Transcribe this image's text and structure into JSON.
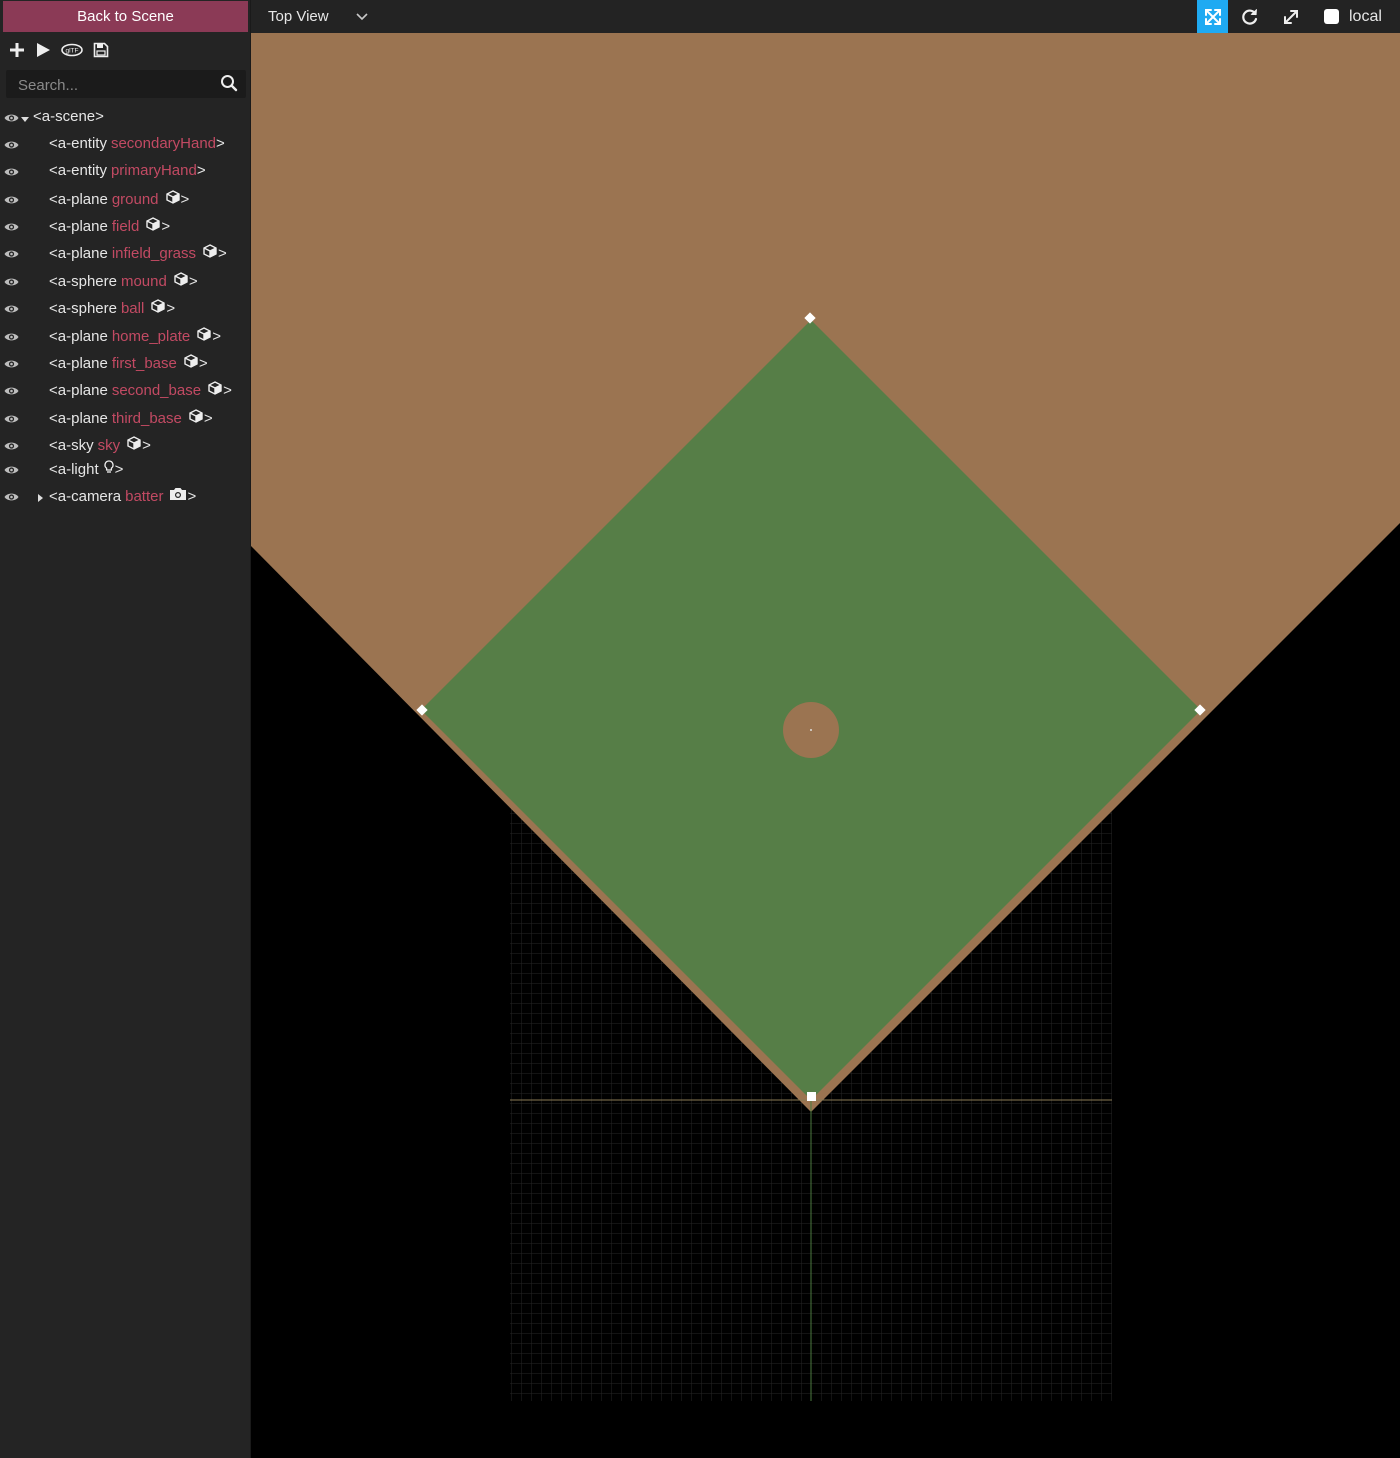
{
  "sidebar": {
    "back_label": "Back to Scene",
    "search_placeholder": "Search...",
    "toolbar_icons": [
      "add-entity-icon",
      "play-icon",
      "gltf-export-icon",
      "save-icon"
    ]
  },
  "outliner": {
    "root": "<a-scene>",
    "rows": [
      {
        "tag": "<a-entity",
        "name": "secondaryHand",
        "icon": "none",
        "close": ">"
      },
      {
        "tag": "<a-entity",
        "name": "primaryHand",
        "icon": "none",
        "close": ">"
      },
      {
        "tag": "<a-plane",
        "name": "ground",
        "icon": "cube-icon",
        "close": ">"
      },
      {
        "tag": "<a-plane",
        "name": "field",
        "icon": "cube-icon",
        "close": ">"
      },
      {
        "tag": "<a-plane",
        "name": "infield_grass",
        "icon": "cube-icon",
        "close": ">"
      },
      {
        "tag": "<a-sphere",
        "name": "mound",
        "icon": "cube-icon",
        "close": ">"
      },
      {
        "tag": "<a-sphere",
        "name": "ball",
        "icon": "cube-icon",
        "close": ">"
      },
      {
        "tag": "<a-plane",
        "name": "home_plate",
        "icon": "cube-icon",
        "close": ">"
      },
      {
        "tag": "<a-plane",
        "name": "first_base",
        "icon": "cube-icon",
        "close": ">"
      },
      {
        "tag": "<a-plane",
        "name": "second_base",
        "icon": "cube-icon",
        "close": ">"
      },
      {
        "tag": "<a-plane",
        "name": "third_base",
        "icon": "cube-icon",
        "close": ">"
      },
      {
        "tag": "<a-sky",
        "name": "sky",
        "icon": "cube-icon",
        "close": ">"
      },
      {
        "tag": "<a-light",
        "name": "",
        "icon": "bulb-icon",
        "close": ">"
      },
      {
        "tag": "<a-camera",
        "name": "batter",
        "icon": "camera-icon",
        "close": ">"
      }
    ]
  },
  "topbar": {
    "view": "Top View",
    "tools": [
      "translate-icon",
      "rotate-icon",
      "scale-icon"
    ],
    "active_tool": "translate-icon",
    "local_label": "local"
  },
  "colors": {
    "accent": "#8b3a56",
    "entity_name": "#c24a63",
    "active_tool": "#1faaf2",
    "dirt": "#9b7451",
    "grass": "#567e47",
    "grid": "#2a2a2a"
  }
}
